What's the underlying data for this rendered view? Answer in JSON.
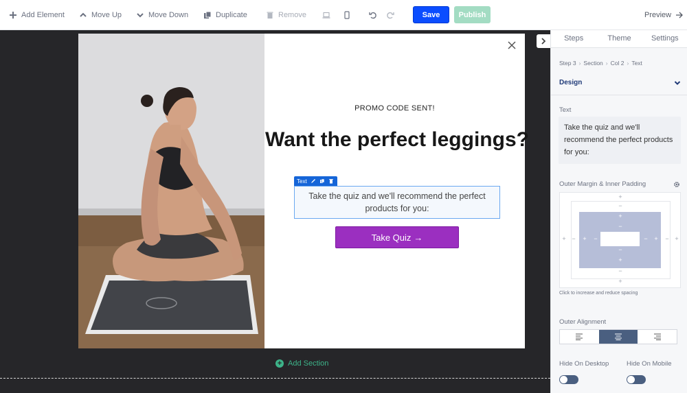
{
  "toolbar": {
    "add_element": "Add Element",
    "move_up": "Move Up",
    "move_down": "Move Down",
    "duplicate": "Duplicate",
    "remove": "Remove",
    "save": "Save",
    "publish": "Publish",
    "preview": "Preview"
  },
  "popup": {
    "promo_text": "PROMO CODE SENT!",
    "headline": "Want the perfect leggings?",
    "body_text": "Take the quiz and we'll recommend the perfect products for you:",
    "button_label": "Take Quiz",
    "element_tag": "Text"
  },
  "canvas": {
    "add_section": "Add Section"
  },
  "panel": {
    "tabs": [
      "Steps",
      "Theme",
      "Settings"
    ],
    "breadcrumb": [
      "Step 3",
      "Section",
      "Col 2",
      "Text"
    ],
    "design_label": "Design",
    "text_label": "Text",
    "text_value": "Take the quiz and we'll recommend the perfect products for you:",
    "spacing_label": "Outer Margin & Inner Padding",
    "spacing_hint": "Click to increase and reduce spacing",
    "alignment_label": "Outer Alignment",
    "alignment_selected": "center",
    "hide_desktop_label": "Hide On Desktop",
    "hide_mobile_label": "Hide On Mobile",
    "hide_desktop": false,
    "hide_mobile": false
  },
  "colors": {
    "save": "#0b4dff",
    "publish": "#a3dcc3",
    "quiz_button": "#9b2fc0",
    "accent_green": "#3db389",
    "panel_accent": "#4a5f80"
  }
}
